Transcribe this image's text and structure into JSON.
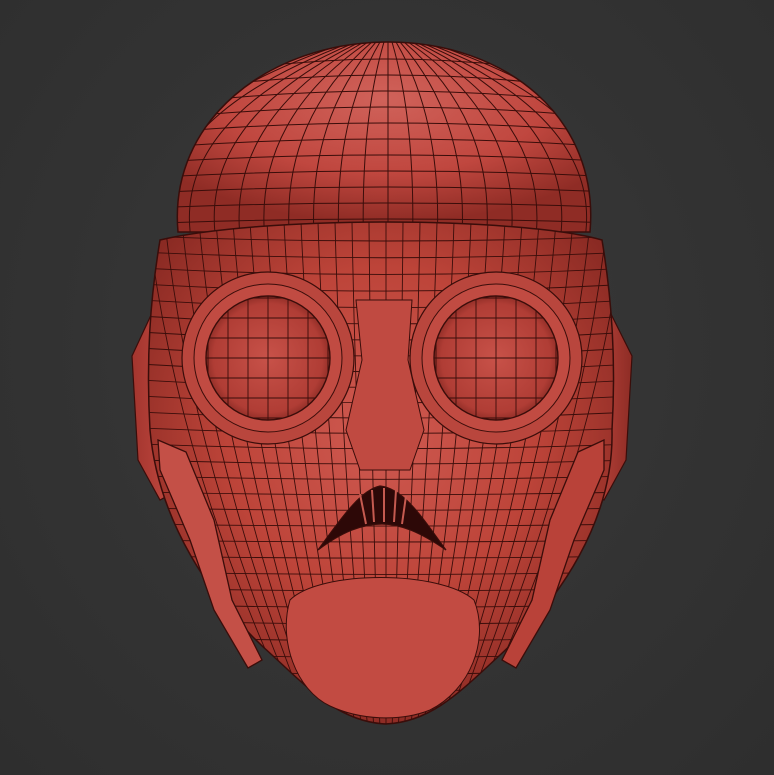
{
  "viewport": {
    "background_color": "#333333"
  },
  "model": {
    "subject": "red-mask-head-wireframe",
    "base_color": "#c0473f",
    "shadow_color": "#7a211c",
    "highlight_color": "#d77068",
    "wire_color": "#3a0d0a",
    "display_mode": "polyframe"
  }
}
